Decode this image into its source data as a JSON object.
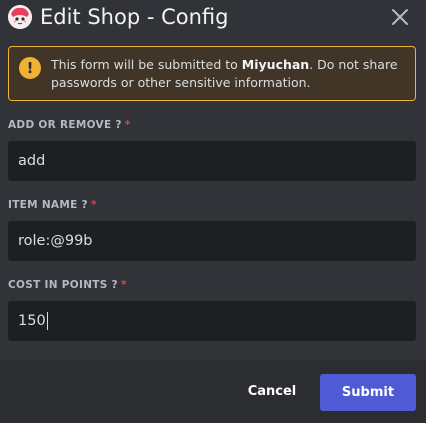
{
  "header": {
    "title": "Edit Shop - Config",
    "app_icon": "app-avatar-icon",
    "close_icon": "close-icon"
  },
  "warning": {
    "icon": "warning-icon",
    "icon_glyph": "!",
    "text_before": "This form will be submitted to ",
    "app_name": "Miyuchan",
    "text_after": ". Do not share passwords or other sensitive information."
  },
  "fields": [
    {
      "label": "ADD OR REMOVE ?",
      "required_mark": "*",
      "value": "add"
    },
    {
      "label": "ITEM NAME ?",
      "required_mark": "*",
      "value": "role:@99b"
    },
    {
      "label": "COST IN POINTS ?",
      "required_mark": "*",
      "value": "150"
    }
  ],
  "footer": {
    "cancel_label": "Cancel",
    "submit_label": "Submit"
  },
  "colors": {
    "background": "#313338",
    "input_background": "#1e1f22",
    "footer_background": "#2b2d31",
    "warning_border": "#f0b232",
    "required": "#f23f43",
    "submit": "#4f5bd5"
  }
}
